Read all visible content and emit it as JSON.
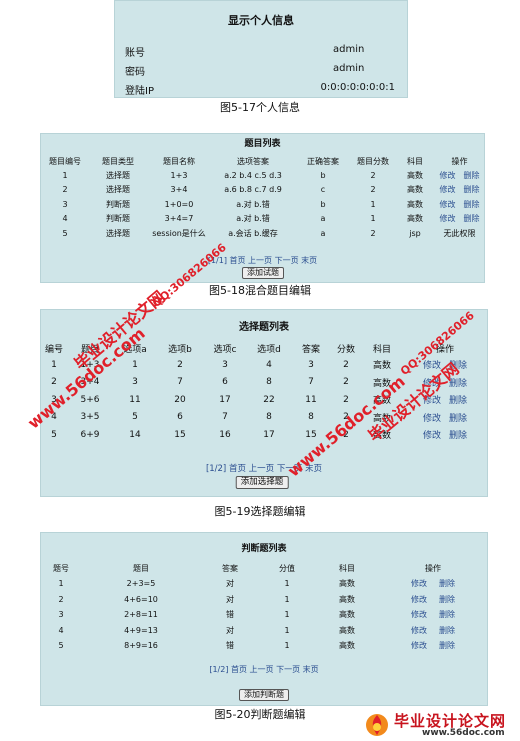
{
  "user_info": {
    "title": "显示个人信息",
    "rows": [
      {
        "label": "账号",
        "value": "admin"
      },
      {
        "label": "密码",
        "value": "admin"
      },
      {
        "label": "登陆IP",
        "value": "0:0:0:0:0:0:0:1"
      }
    ],
    "caption": "图5-17个人信息"
  },
  "question_list": {
    "title": "题目列表",
    "headers": [
      "题目编号",
      "题目类型",
      "题目名称",
      "选项答案",
      "正确答案",
      "题目分数",
      "科目",
      "操作"
    ],
    "rows": [
      [
        "1",
        "选择题",
        "1+3",
        "a.2 b.4 c.5 d.3",
        "b",
        "2",
        "高数"
      ],
      [
        "2",
        "选择题",
        "3+4",
        "a.6 b.8 c.7 d.9",
        "c",
        "2",
        "高数"
      ],
      [
        "3",
        "判断题",
        "1+0=0",
        "a.对 b.错",
        "b",
        "1",
        "高数"
      ],
      [
        "4",
        "判断题",
        "3+4=7",
        "a.对 b.错",
        "a",
        "1",
        "高数"
      ],
      [
        "5",
        "选择题",
        "session是什么",
        "a.会话 b.缓存",
        "a",
        "2",
        "jsp"
      ]
    ],
    "actions": [
      "修改",
      "删除"
    ],
    "no_permission": "无此权限",
    "pager": "[1/1] 首页 上一页 下一页 末页",
    "add_button": "添加试题",
    "caption": "图5-18混合题目编辑"
  },
  "choice_list": {
    "title": "选择题列表",
    "headers": [
      "编号",
      "题目",
      "选项a",
      "选项b",
      "选项c",
      "选项d",
      "答案",
      "分数",
      "科目",
      "操作"
    ],
    "rows": [
      [
        "1",
        "1+3",
        "1",
        "2",
        "3",
        "4",
        "3",
        "2",
        "高数"
      ],
      [
        "2",
        "3+4",
        "3",
        "7",
        "6",
        "8",
        "7",
        "2",
        "高数"
      ],
      [
        "3",
        "5+6",
        "11",
        "20",
        "17",
        "22",
        "11",
        "2",
        "高数"
      ],
      [
        "4",
        "3+5",
        "5",
        "6",
        "7",
        "8",
        "8",
        "2",
        "高数"
      ],
      [
        "5",
        "6+9",
        "14",
        "15",
        "16",
        "17",
        "15",
        "2",
        "高数"
      ]
    ],
    "actions": [
      "修改",
      "删除"
    ],
    "pager": "[1/2] 首页 上一页 下一页 末页",
    "add_button": "添加选择题",
    "caption": "图5-19选择题编辑"
  },
  "judge_list": {
    "title": "判断题列表",
    "headers": [
      "题号",
      "题目",
      "答案",
      "分值",
      "科目",
      "操作"
    ],
    "rows": [
      [
        "1",
        "2+3=5",
        "对",
        "1",
        "高数"
      ],
      [
        "2",
        "4+6=10",
        "对",
        "1",
        "高数"
      ],
      [
        "3",
        "2+8=11",
        "错",
        "1",
        "高数"
      ],
      [
        "4",
        "4+9=13",
        "对",
        "1",
        "高数"
      ],
      [
        "5",
        "8+9=16",
        "错",
        "1",
        "高数"
      ]
    ],
    "actions": [
      "修改",
      "删除"
    ],
    "pager": "[1/2] 首页 上一页 下一页 末页",
    "add_button": "添加判断题",
    "caption": "图5-20判断题编辑"
  },
  "watermarks": {
    "brand": "毕业设计论文网",
    "site": "www.56doc.com",
    "qq": "QQ:306826066",
    "footer_brand": "毕业设计论文网",
    "footer_site": "www.56doc.com"
  }
}
